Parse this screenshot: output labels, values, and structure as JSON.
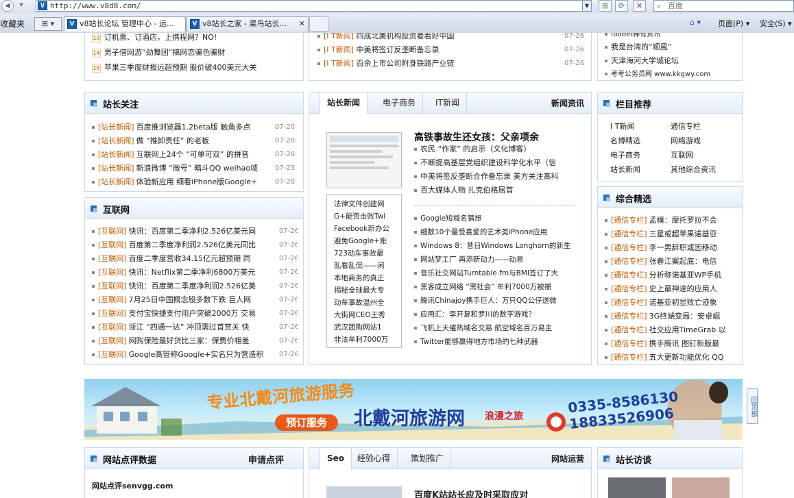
{
  "browser": {
    "address": "http://www.v8d8.com/",
    "search_placeholder": "百度",
    "favorites_label": "收藏夹",
    "tabs": [
      {
        "label": "v8站长论坛 管理中心 - 运..."
      },
      {
        "label": "v8站长之家 - 菜鸟站长..."
      }
    ],
    "commands": {
      "page": "页面(P)",
      "safety": "安全(S)"
    }
  },
  "top": {
    "numbered": [
      {
        "n": "13",
        "text": "订机票、订酒店，上携程网？NO!"
      },
      {
        "n": "14",
        "text": "男子借网游“劲舞团”搞网恋骗色骗财"
      },
      {
        "n": "15",
        "text": "苹果三季度财报远超预期 股价破400美元大关"
      }
    ],
    "it_news": [
      {
        "cat": "[I T新闻]",
        "text": "四成北美机构投资者看好中国",
        "date": "07-26"
      },
      {
        "cat": "[I T新闻]",
        "text": "中美将签订反垄断备忘录",
        "date": "07-26"
      },
      {
        "cat": "[I T新闻]",
        "text": "百余上市公司附身铁路产业链",
        "date": "07-26"
      }
    ],
    "right_links": [
      "foobet棒有货讯",
      "我是台湾的“顺風”",
      "天津海河大学城论坛",
      "考考公务员网 www.kkgwy.com"
    ]
  },
  "zhanzhang": {
    "title": "站长关注",
    "items": [
      {
        "cat": "[站长新闻]",
        "text": "百度推浏览器1.2beta版 触角多点",
        "date": "07-20"
      },
      {
        "cat": "[站长新闻]",
        "text": "做 “推卸责任” 的老板",
        "date": "07-20"
      },
      {
        "cat": "[站长新闻]",
        "text": "互联网上24个 “可单可双” 的拼音",
        "date": "07-20"
      },
      {
        "cat": "[站长新闻]",
        "text": "新浪微博 “微号” 暗斗QQ weihao域",
        "date": "07-23"
      },
      {
        "cat": "[站长新闻]",
        "text": "体验新应用 细看iPhone版Google+",
        "date": "07-20"
      }
    ]
  },
  "hulianwang": {
    "title": "互联网",
    "items": [
      {
        "cat": "[互联网]",
        "text": "快讯：百度第二季净利2.526亿美元同",
        "date": "07-26"
      },
      {
        "cat": "[互联网]",
        "text": "百度第二季度净利润2.526亿美元同比",
        "date": "07-26"
      },
      {
        "cat": "[互联网]",
        "text": "百度二季度营收34.15亿元超预期 同",
        "date": "07-26"
      },
      {
        "cat": "[互联网]",
        "text": "快讯：Netflix第二季净利6800万美元",
        "date": "07-26"
      },
      {
        "cat": "[互联网]",
        "text": "快讯：百度第二季度净利润2.526亿美",
        "date": "07-26"
      },
      {
        "cat": "[互联网]",
        "text": "7月25日中国概念股多数下跌 巨人网",
        "date": "07-26"
      },
      {
        "cat": "[互联网]",
        "text": "支付宝快捷支付用户突破2000万 交易",
        "date": "07-26"
      },
      {
        "cat": "[互联网]",
        "text": "浙江 “四通一达” 冲顶需过首赏关 快",
        "date": "07-26"
      },
      {
        "cat": "[互联网]",
        "text": "网购保险最好货比三家：保费价相差",
        "date": "07-26"
      },
      {
        "cat": "[互联网]",
        "text": "Google高管称Google+实名只为营造积",
        "date": "07-26"
      }
    ]
  },
  "news": {
    "tabs": [
      "站长新闻",
      "电子商务",
      "IT新闻"
    ],
    "more": "新闻资讯",
    "headline": "高铁事故生还女孩：父亲项余",
    "col_list": [
      "法律文件创建网",
      "G+能否击败Twi",
      "Facebook新办公",
      "避免Google+账",
      "723动车事故最",
      "乱看乱侃——闲",
      "本地商务的真正",
      "揭秘全球最大专",
      "动车事故温州全",
      "大街网CEO王秀",
      "武汉团购网站1",
      "非法牟利7000万"
    ],
    "list_a": [
      "农民 “作家” 的启示（文化博客）",
      "不断提高基层党组织建设科学化水平（信",
      "中美将签反垄断合作备忘录 美方关注高科",
      "百大媒体人物 扎克伯格居首"
    ],
    "list_b": [
      "Google短域名猜想",
      "细数10个最受喜爱的艺术类iPhone应用",
      "Windows 8：昔日Windows Longhorn的新生",
      "网站梦工厂 再添新动力——动易",
      "音乐社交网站Turntable.fm与BMI签订了大",
      "黑客成立网络 “黑社会” 牟利7000万被捕",
      "腾讯Chinajoy携手巨人：万只QQ公仔送微",
      "应用汇：李开复和罗川的数字游戏？",
      "飞机上天催热域名交易 航空域名百万易主",
      "Twitter能够赢得地方市场的七种武器"
    ]
  },
  "lanmu": {
    "title": "栏目推荐",
    "links": [
      "I T新闻",
      "通信专栏",
      "名博精选",
      "网络游戏",
      "电子商务",
      "互联网",
      "站长新闻",
      "其他综合资讯"
    ]
  },
  "zonghe": {
    "title": "综合精选",
    "items": [
      {
        "cat": "[通信专栏]",
        "text": "孟樸：摩托罗拉不会"
      },
      {
        "cat": "[通信专栏]",
        "text": "三星或超苹果诺基亚"
      },
      {
        "cat": "[通信专栏]",
        "text": "李一男辞职或因移动"
      },
      {
        "cat": "[通信专栏]",
        "text": "张春江案起底：电信"
      },
      {
        "cat": "[通信专栏]",
        "text": "分析称诺基亚WP手机"
      },
      {
        "cat": "[通信专栏]",
        "text": "史上最神速的应用人"
      },
      {
        "cat": "[通信专栏]",
        "text": "诺基亚初显败亡迹象"
      },
      {
        "cat": "[通信专栏]",
        "text": "3G终端变局：安卓崛"
      },
      {
        "cat": "[通信专栏]",
        "text": "社交应用TimeGrab 以"
      },
      {
        "cat": "[通信专栏]",
        "text": "携手腾讯 图钉新版最"
      },
      {
        "cat": "[通信专栏]",
        "text": "五大更新功能优化 QQ"
      }
    ]
  },
  "banner": {
    "slogan": "专业北戴河旅游服务",
    "brand": "北戴河旅游网",
    "tag": "浪漫之旅",
    "button": "预订服务",
    "phone1": "0335-8586130",
    "phone2": "18833526906",
    "backtop": "回顶部"
  },
  "bottom": {
    "dianping_title": "网站点评数据",
    "dianping_link": "申请点评",
    "dianping_first": "网站点评senvgg.com",
    "tabs": [
      "Seo",
      "经验心得",
      "策划推广"
    ],
    "tabs_more": "网站运营",
    "bottom_headline": "百度K站站长应及时采取应对",
    "fangtan_title": "站长访谈"
  }
}
